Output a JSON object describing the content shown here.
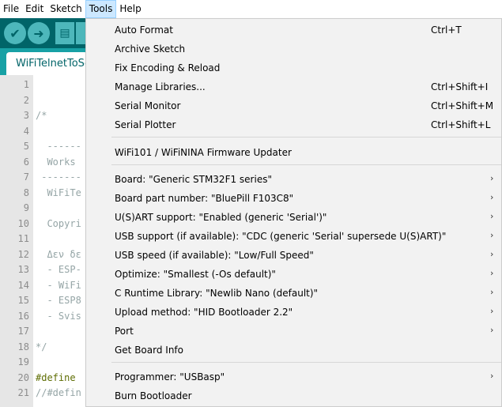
{
  "menubar": {
    "items": [
      "File",
      "Edit",
      "Sketch",
      "Tools",
      "Help"
    ]
  },
  "toolbar": {
    "verify_icon": "check-icon",
    "upload_icon": "arrow-right-icon",
    "new_icon": "document-icon"
  },
  "tab": {
    "label": "WiFiTelnetToSerial"
  },
  "editor": {
    "line_numbers": [
      "1",
      "2",
      "3",
      "4",
      "5",
      "6",
      "7",
      "8",
      "9",
      "10",
      "11",
      "12",
      "13",
      "14",
      "15",
      "16",
      "17",
      "18",
      "19",
      "20",
      "21"
    ],
    "lines": [
      "",
      "",
      "/*",
      "",
      "  ------",
      "  Works",
      " -------",
      "  WiFiTe",
      "",
      "  Copyri",
      "",
      "  Δεν δε",
      "  - ESP-",
      "  - WiFi",
      "  - ESP8",
      "  - Svis",
      "",
      "*/",
      "",
      "#define",
      "//#defin"
    ]
  },
  "tools_menu": {
    "group1": [
      {
        "label": "Auto Format",
        "shortcut": "Ctrl+T"
      },
      {
        "label": "Archive Sketch",
        "shortcut": ""
      },
      {
        "label": "Fix Encoding & Reload",
        "shortcut": ""
      },
      {
        "label": "Manage Libraries...",
        "shortcut": "Ctrl+Shift+I"
      },
      {
        "label": "Serial Monitor",
        "shortcut": "Ctrl+Shift+M"
      },
      {
        "label": "Serial Plotter",
        "shortcut": "Ctrl+Shift+L"
      }
    ],
    "group2": [
      {
        "label": "WiFi101 / WiFiNINA Firmware Updater"
      }
    ],
    "group3": [
      {
        "label": "Board: \"Generic STM32F1 series\"",
        "submenu": true
      },
      {
        "label": "Board part number: \"BluePill F103C8\"",
        "submenu": true
      },
      {
        "label": "U(S)ART support: \"Enabled (generic 'Serial')\"",
        "submenu": true
      },
      {
        "label": "USB support (if available): \"CDC (generic 'Serial' supersede U(S)ART)\"",
        "submenu": true
      },
      {
        "label": "USB speed (if available): \"Low/Full Speed\"",
        "submenu": true
      },
      {
        "label": "Optimize: \"Smallest (-Os default)\"",
        "submenu": true
      },
      {
        "label": "C Runtime Library: \"Newlib Nano (default)\"",
        "submenu": true
      },
      {
        "label": "Upload method: \"HID Bootloader 2.2\"",
        "submenu": true
      },
      {
        "label": "Port",
        "submenu": true
      },
      {
        "label": "Get Board Info",
        "submenu": false
      }
    ],
    "group4": [
      {
        "label": "Programmer: \"USBasp\"",
        "submenu": true
      },
      {
        "label": "Burn Bootloader",
        "submenu": false
      }
    ],
    "submenu_arrow": "›"
  },
  "colors": {
    "toolbar_bg": "#006468",
    "tabbar_bg": "#17a1a5",
    "menu_bg": "#f2f2f2",
    "active_menu": "#cce8ff"
  }
}
